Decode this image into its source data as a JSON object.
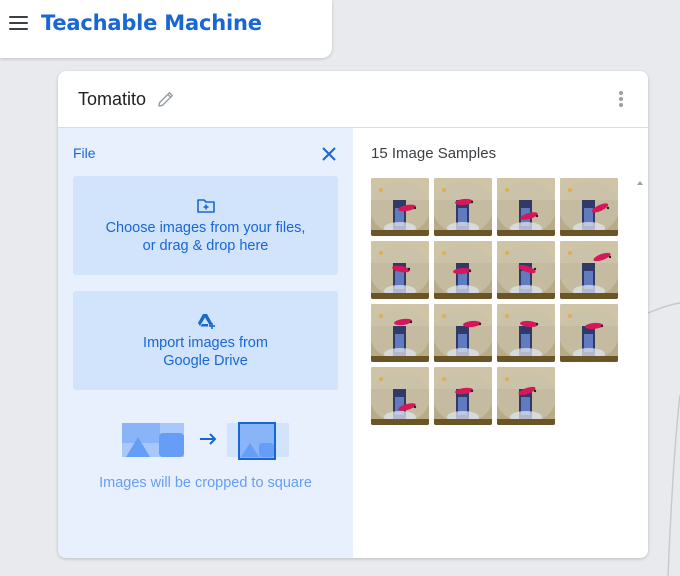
{
  "app": {
    "title": "Teachable Machine"
  },
  "class_card": {
    "name": "Tomatito",
    "upload_panel": {
      "mode_label": "File",
      "choose_files": {
        "line1": "Choose images from your files,",
        "line2": "or drag & drop here"
      },
      "import_drive": {
        "line1": "Import images from",
        "line2": "Google Drive"
      },
      "crop_note": "Images will be cropped to square"
    },
    "samples": {
      "title": "15 Image Samples",
      "count": 15
    }
  },
  "icons": {
    "menu": "hamburger-menu-icon",
    "edit": "pencil-icon",
    "more": "more-vert-icon",
    "close": "close-icon",
    "folder": "folder-add-icon",
    "drive": "google-drive-add-icon"
  },
  "colors": {
    "brand": "#1967d2",
    "panel_bg": "#e8f0fe",
    "option_bg": "#d2e3fc",
    "note": "#669df6"
  }
}
